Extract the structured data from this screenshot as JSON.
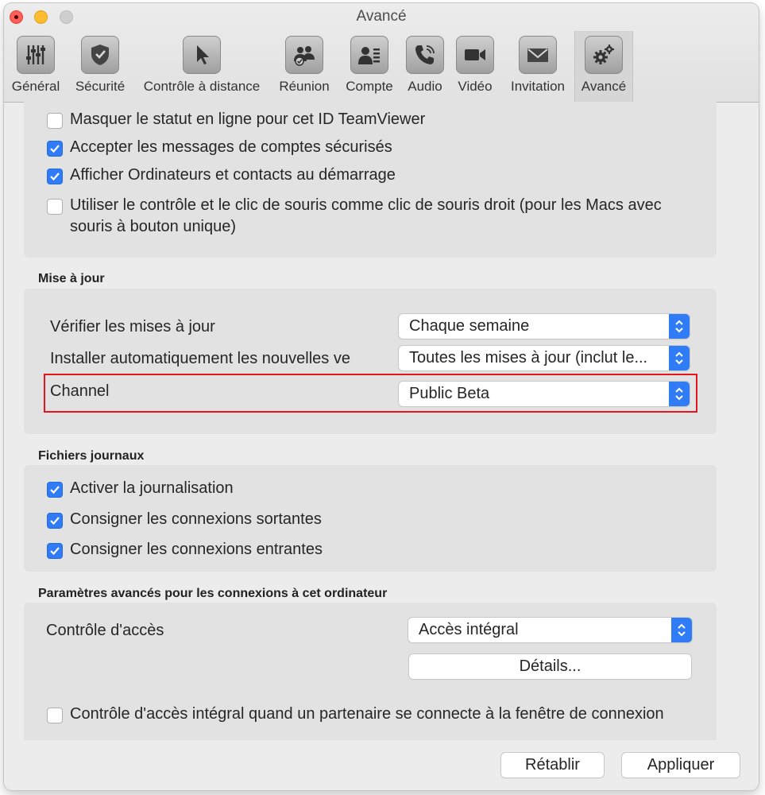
{
  "window": {
    "title": "Avancé"
  },
  "tabs": [
    {
      "label": "Général",
      "icon": "sliders-icon"
    },
    {
      "label": "Sécurité",
      "icon": "shield-icon"
    },
    {
      "label": "Contrôle à distance",
      "icon": "cursor-icon"
    },
    {
      "label": "Réunion",
      "icon": "people-icon"
    },
    {
      "label": "Compte",
      "icon": "account-card-icon"
    },
    {
      "label": "Audio",
      "icon": "phone-icon"
    },
    {
      "label": "Vidéo",
      "icon": "video-camera-icon"
    },
    {
      "label": "Invitation",
      "icon": "envelope-icon"
    },
    {
      "label": "Avancé",
      "icon": "gears-icon",
      "active": true
    }
  ],
  "general_options": [
    {
      "label": "Masquer le statut en ligne pour cet ID TeamViewer",
      "checked": false
    },
    {
      "label": "Accepter les messages de comptes sécurisés",
      "checked": true
    },
    {
      "label": "Afficher Ordinateurs et contacts au démarrage",
      "checked": true
    },
    {
      "label": "Utiliser le contrôle et le clic de souris comme clic de souris droit (pour les Macs avec souris à bouton unique)",
      "checked": false
    }
  ],
  "update": {
    "title": "Mise à jour",
    "check_label": "Vérifier les mises à jour",
    "check_value": "Chaque semaine",
    "install_label": "Installer automatiquement les nouvelles ve",
    "install_value": "Toutes les mises à jour (inclut le...",
    "channel_label": "Channel",
    "channel_value": "Public Beta"
  },
  "logs": {
    "title": "Fichiers journaux",
    "options": [
      {
        "label": "Activer la journalisation",
        "checked": true
      },
      {
        "label": "Consigner les connexions sortantes",
        "checked": true
      },
      {
        "label": "Consigner les connexions entrantes",
        "checked": true
      }
    ]
  },
  "advanced": {
    "title": "Paramètres avancés pour les connexions à cet ordinateur",
    "access_label": "Contrôle d'accès",
    "access_value": "Accès intégral",
    "details_label": "Détails...",
    "login_option": {
      "label": "Contrôle d'accès intégral quand un partenaire se connecte à la fenêtre de connexion",
      "checked": false
    }
  },
  "footer": {
    "reset_label": "Rétablir",
    "apply_label": "Appliquer"
  },
  "colors": {
    "accent": "#2f7cf6",
    "highlight_border": "#e3161d",
    "window_bg": "#ececec",
    "panel_bg": "#e2e2e2"
  }
}
